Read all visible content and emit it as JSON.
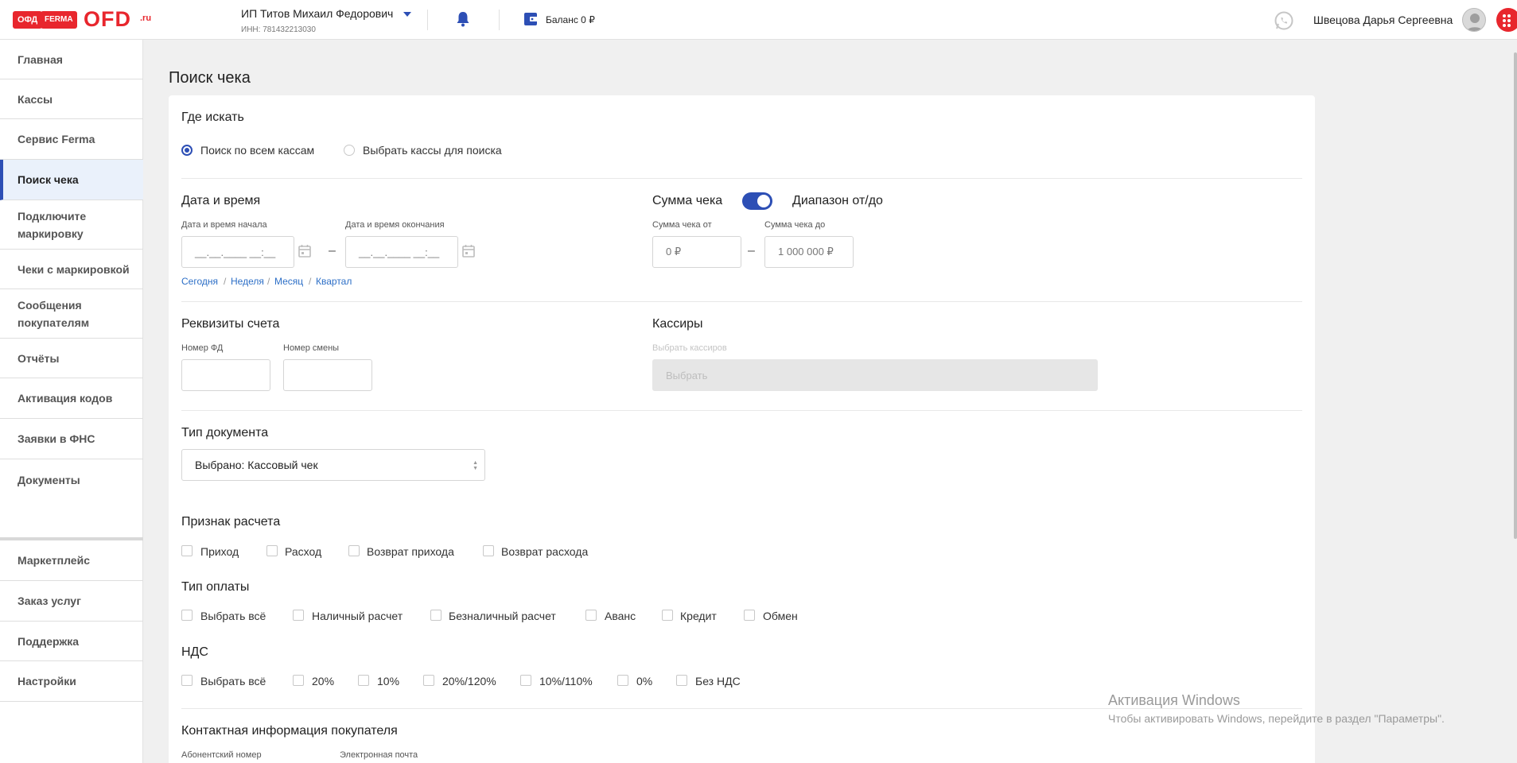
{
  "header": {
    "logo_ofd": "ОФД",
    "logo_ferma": "FERMA",
    "logo_big": "OFD",
    "logo_ru": ".ru",
    "org_name": "ИП Титов Михаил Федорович",
    "org_inn": "ИНН: 781432213030",
    "balance": "Баланс 0 ₽",
    "user_name": "Швецова Дарья Сергеевна",
    "icons": [
      "bell-icon",
      "wallet-icon",
      "whatsapp-icon",
      "apps-icon"
    ]
  },
  "sidebar": {
    "items": [
      {
        "label": "Главная"
      },
      {
        "label": "Кассы"
      },
      {
        "label": "Сервис Ferma"
      },
      {
        "label": "Поиск чека",
        "active": true
      },
      {
        "label": "Подключите маркировку"
      },
      {
        "label": "Чеки с маркировкой"
      },
      {
        "label": "Сообщения покупателям"
      },
      {
        "label": "Отчёты"
      },
      {
        "label": "Активация кодов"
      },
      {
        "label": "Заявки в ФНС"
      },
      {
        "label": "Документы"
      },
      {
        "label": "Маркетплейс"
      },
      {
        "label": "Заказ услуг"
      },
      {
        "label": "Поддержка"
      },
      {
        "label": "Настройки"
      }
    ]
  },
  "page": {
    "title": "Поиск чека"
  },
  "where": {
    "title": "Где искать",
    "options": [
      "Поиск по всем кассам",
      "Выбрать кассы для поиска"
    ],
    "selected": 0
  },
  "datetime": {
    "title": "Дата и время",
    "start_label": "Дата и время начала",
    "end_label": "Дата и время окончания",
    "start_value": "__.__.____ __:__",
    "end_value": "__.__.____ __:__",
    "dash": "–",
    "quick": [
      "Сегодня",
      "Неделя",
      "Месяц",
      "Квартал"
    ],
    "quick_sep": "/"
  },
  "amount": {
    "title": "Сумма чека",
    "range_label": "Диапазон от/до",
    "range_enabled": true,
    "from_label": "Сумма чека от",
    "to_label": "Сумма чека до",
    "from_placeholder": "0 ₽",
    "to_placeholder": "1 000 000 ₽",
    "dash": "–"
  },
  "requisites": {
    "title": "Реквизиты счета",
    "fd_label": "Номер ФД",
    "shift_label": "Номер смены"
  },
  "cashiers": {
    "title": "Кассиры",
    "label": "Выбрать кассиров",
    "placeholder": "Выбрать"
  },
  "doc_type": {
    "title": "Тип документа",
    "value": "Выбрано:  Кассовый чек"
  },
  "calc_sign": {
    "title": "Признак расчета",
    "options": [
      "Приход",
      "Расход",
      "Возврат прихода",
      "Возврат расхода"
    ]
  },
  "payment_type": {
    "title": "Тип оплаты",
    "options": [
      "Выбрать всё",
      "Наличный расчет",
      "Безналичный расчет",
      "Аванс",
      "Кредит",
      "Обмен"
    ]
  },
  "vat": {
    "title": "НДС",
    "options": [
      "Выбрать всё",
      "20%",
      "10%",
      "20%/120%",
      "10%/110%",
      "0%",
      "Без НДС"
    ]
  },
  "contact": {
    "title": "Контактная информация покупателя",
    "phone_label": "Абонентский номер",
    "email_label": "Электронная почта"
  },
  "watermark": {
    "title": "Активация Windows",
    "subtitle": "Чтобы активировать Windows, перейдите в раздел \"Параметры\"."
  },
  "colors": {
    "brand_red": "#e8262d",
    "accent_blue": "#2d4fb5",
    "link_blue": "#2d6fc7"
  }
}
